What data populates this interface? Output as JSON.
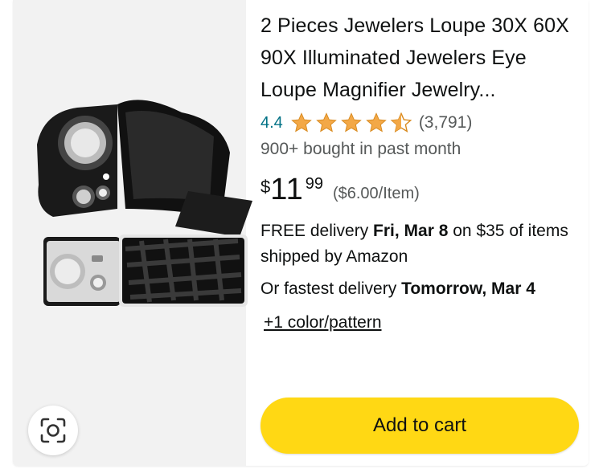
{
  "product": {
    "title": "2 Pieces Jewelers Loupe 30X 60X 90X Illuminated Jewelers Eye Loupe Magnifier Jewelry...",
    "rating": "4.4",
    "stars_value": 4.4,
    "rating_count": "(3,791)",
    "bought": "900+ bought in past month",
    "price": {
      "symbol": "$",
      "whole": "11",
      "fraction": "99",
      "unit_price": "($6.00/Item)"
    },
    "delivery": {
      "prefix": "FREE delivery ",
      "date": "Fri, Mar 8",
      "suffix": " on $35 of items shipped by Amazon"
    },
    "fastest": {
      "prefix": "Or fastest delivery ",
      "date": "Tomorrow, Mar 4"
    },
    "variants_link": "+1 color/pattern",
    "add_to_cart_label": "Add to cart"
  },
  "colors": {
    "star": "#f3a847",
    "link_teal": "#007185",
    "button_yellow": "#ffd814",
    "muted_text": "#565959"
  },
  "icons": {
    "visual_search": "camera-lens-icon"
  }
}
